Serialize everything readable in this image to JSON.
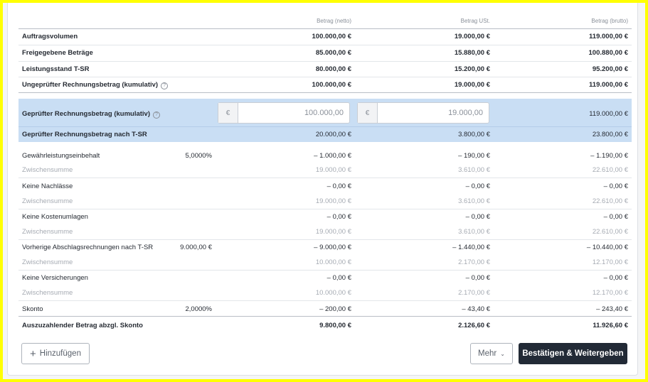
{
  "columns": {
    "netto": "Betrag (netto)",
    "ust": "Betrag USt.",
    "brutto": "Betrag (brutto)"
  },
  "summary_rows": [
    {
      "label": "Auftragsvolumen",
      "netto": "100.000,00 €",
      "ust": "19.000,00 €",
      "brutto": "119.000,00 €"
    },
    {
      "label": "Freigegebene Beträge",
      "netto": "85.000,00 €",
      "ust": "15.880,00 €",
      "brutto": "100.880,00 €"
    },
    {
      "label": "Leistungsstand T-SR",
      "netto": "80.000,00 €",
      "ust": "15.200,00 €",
      "brutto": "95.200,00 €"
    },
    {
      "label": "Ungeprüfter Rechnungsbetrag (kumulativ)",
      "netto": "100.000,00 €",
      "ust": "19.000,00 €",
      "brutto": "119.000,00 €"
    }
  ],
  "checked": {
    "label": "Geprüfter Rechnungsbetrag (kumulativ)",
    "currency": "€",
    "netto_value": "100.000,00",
    "ust_value": "19.000,00",
    "brutto": "119.000,00 €"
  },
  "after_tsr": {
    "label": "Geprüfter Rechnungsbetrag nach T-SR",
    "netto": "20.000,00 €",
    "ust": "3.800,00 €",
    "brutto": "23.800,00 €"
  },
  "deductions": [
    {
      "label": "Gewährleistungseinbehalt",
      "param": "5,0000%",
      "netto": "– 1.000,00 €",
      "ust": "– 190,00 €",
      "brutto": "– 1.190,00 €",
      "subtotal": {
        "label": "Zwischensumme",
        "netto": "19.000,00 €",
        "ust": "3.610,00 €",
        "brutto": "22.610,00 €"
      }
    },
    {
      "label": "Keine Nachlässe",
      "param": "",
      "netto": "– 0,00 €",
      "ust": "– 0,00 €",
      "brutto": "– 0,00 €",
      "subtotal": {
        "label": "Zwischensumme",
        "netto": "19.000,00 €",
        "ust": "3.610,00 €",
        "brutto": "22.610,00 €"
      }
    },
    {
      "label": "Keine Kostenumlagen",
      "param": "",
      "netto": "– 0,00 €",
      "ust": "– 0,00 €",
      "brutto": "– 0,00 €",
      "subtotal": {
        "label": "Zwischensumme",
        "netto": "19.000,00 €",
        "ust": "3.610,00 €",
        "brutto": "22.610,00 €"
      }
    },
    {
      "label": "Vorherige Abschlagsrechnungen nach T-SR",
      "param": "9.000,00 €",
      "netto": "– 9.000,00 €",
      "ust": "– 1.440,00 €",
      "brutto": "– 10.440,00 €",
      "subtotal": {
        "label": "Zwischensumme",
        "netto": "10.000,00 €",
        "ust": "2.170,00 €",
        "brutto": "12.170,00 €"
      }
    },
    {
      "label": "Keine Versicherungen",
      "param": "",
      "netto": "– 0,00 €",
      "ust": "– 0,00 €",
      "brutto": "– 0,00 €",
      "subtotal": {
        "label": "Zwischensumme",
        "netto": "10.000,00 €",
        "ust": "2.170,00 €",
        "brutto": "12.170,00 €"
      }
    }
  ],
  "skonto": {
    "label": "Skonto",
    "param": "2,0000%",
    "netto": "– 200,00 €",
    "ust": "– 43,40 €",
    "brutto": "– 243,40 €"
  },
  "total": {
    "label": "Auszuzahlender Betrag abzgl. Skonto",
    "netto": "9.800,00 €",
    "ust": "2.126,60 €",
    "brutto": "11.926,60 €"
  },
  "buttons": {
    "add_label": "Hinzufügen",
    "more_label": "Mehr",
    "confirm_label": "Bestätigen & Weitergeben"
  },
  "icons": {
    "help": "question-circle-icon",
    "plus": "plus-icon",
    "chevron": "chevron-down-icon"
  },
  "colors": {
    "highlight_band": "#c9def4",
    "primary_button": "#222a36",
    "border_frame": "#ffff00"
  }
}
